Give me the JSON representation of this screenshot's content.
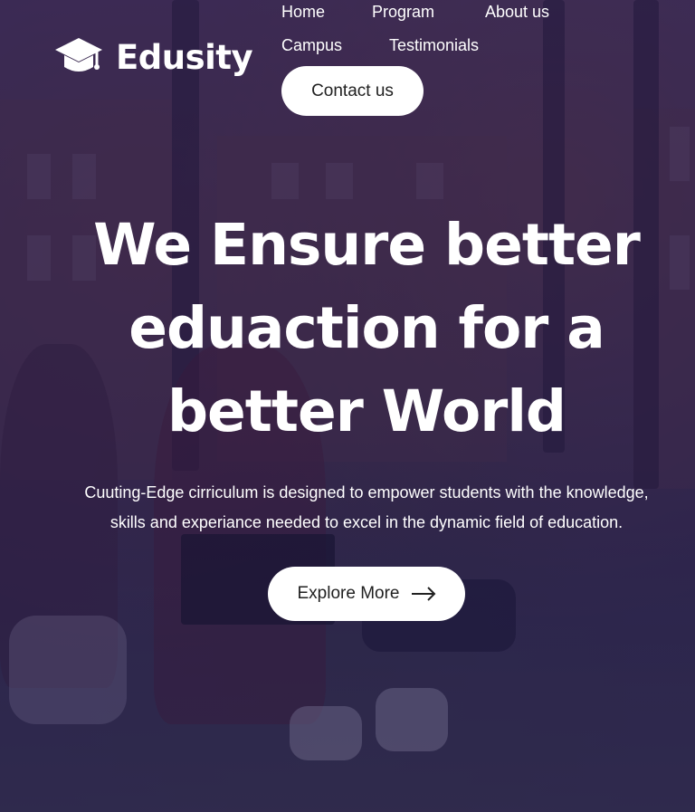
{
  "brand": {
    "name": "Edusity",
    "icon": "graduation-cap-icon"
  },
  "nav": {
    "items": [
      {
        "label": "Home"
      },
      {
        "label": "Program"
      },
      {
        "label": "About us"
      },
      {
        "label": "Campus"
      },
      {
        "label": "Testimonials"
      }
    ],
    "cta_label": "Contact us"
  },
  "hero": {
    "headline_lines": [
      "We Ensure better",
      "eduaction for a",
      "better World"
    ],
    "subtext_lines": [
      "Cuuting-Edge cirriculum is designed to empower students with the knowledge,",
      "skills and experiance needed to excel in the dynamic field of education."
    ],
    "button_label": "Explore More",
    "button_icon": "arrow-right-icon"
  },
  "colors": {
    "overlay": "#1e1646",
    "text": "#ffffff",
    "button_bg": "#ffffff",
    "button_text": "#212121"
  }
}
